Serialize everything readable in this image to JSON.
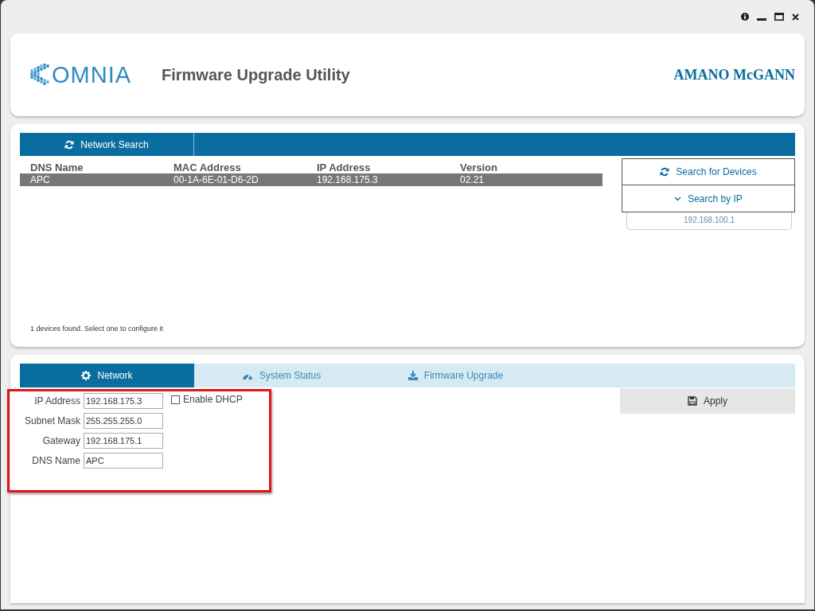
{
  "header": {
    "logo_text": "OMNIA",
    "title": "Firmware Upgrade Utility",
    "brand": "AMANO McGANN"
  },
  "network_search": {
    "tabs": [
      {
        "label": "Network Search",
        "selected": true
      }
    ],
    "columns": [
      "DNS Name",
      "MAC Address",
      "IP Address",
      "Version"
    ],
    "rows": [
      {
        "cells": [
          "APC",
          "00-1A-6E-01-D6-2D",
          "192.168.175.3",
          "02.21"
        ],
        "selected": true
      }
    ],
    "status": "1 devices found. Select one to configure it",
    "search_button": "Search for Devices",
    "search_by_ip": {
      "label": "Search by IP",
      "expanded": true,
      "value": "192.168.100.1"
    }
  },
  "config": {
    "tabs": [
      {
        "label": "Network",
        "selected": true
      },
      {
        "label": "System Status",
        "selected": false
      },
      {
        "label": "Firmware Upgrade",
        "selected": false
      }
    ],
    "fields": [
      {
        "label": "IP Address",
        "value": "192.168.175.3"
      },
      {
        "label": "Subnet Mask",
        "value": "255.255.255.0"
      },
      {
        "label": "Gateway",
        "value": "192.168.175.1"
      },
      {
        "label": "DNS Name",
        "value": "APC"
      }
    ],
    "dhcp": {
      "label": "Enable DHCP",
      "checked": false
    },
    "apply": "Apply"
  }
}
